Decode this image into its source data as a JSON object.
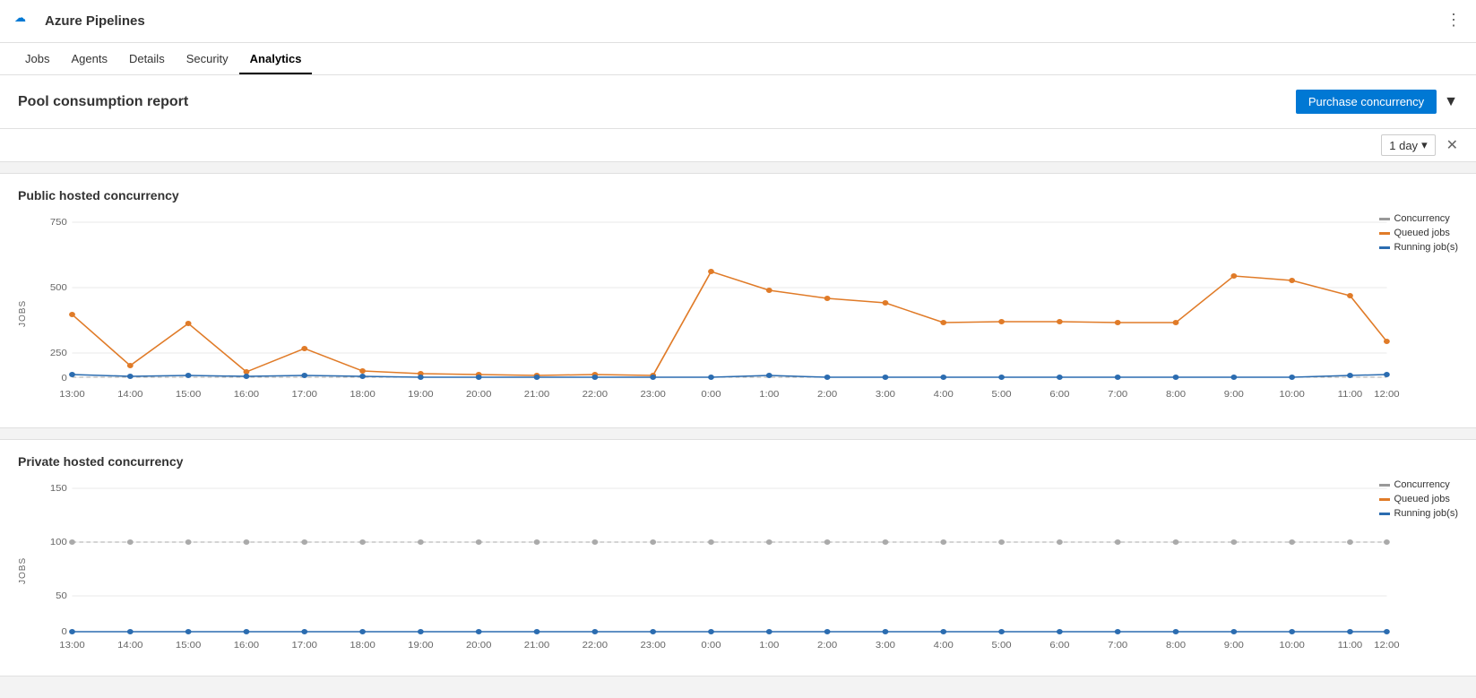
{
  "app": {
    "icon": "☁",
    "title": "Azure Pipelines",
    "more_icon": "⋮"
  },
  "nav": {
    "items": [
      {
        "id": "jobs",
        "label": "Jobs",
        "active": false
      },
      {
        "id": "agents",
        "label": "Agents",
        "active": false
      },
      {
        "id": "details",
        "label": "Details",
        "active": false
      },
      {
        "id": "security",
        "label": "Security",
        "active": false
      },
      {
        "id": "analytics",
        "label": "Analytics",
        "active": true
      }
    ]
  },
  "page": {
    "title": "Pool consumption report",
    "purchase_btn": "Purchase concurrency",
    "day_selector": "1 day"
  },
  "legend": {
    "concurrency": "Concurrency",
    "queued": "Queued jobs",
    "running": "Running job(s)"
  },
  "public_chart": {
    "title": "Public hosted concurrency",
    "y_label": "JOBS",
    "y_max": 750,
    "y_ticks": [
      0,
      250,
      500,
      750
    ],
    "x_ticks": [
      "13:00",
      "14:00",
      "15:00",
      "16:00",
      "17:00",
      "18:00",
      "19:00",
      "20:00",
      "21:00",
      "22:00",
      "23:00",
      "0:00",
      "1:00",
      "2:00",
      "3:00",
      "4:00",
      "5:00",
      "6:00",
      "7:00",
      "8:00",
      "9:00",
      "10:00",
      "11:00",
      "12:00"
    ]
  },
  "private_chart": {
    "title": "Private hosted concurrency",
    "y_label": "JOBS",
    "y_max": 150,
    "y_ticks": [
      0,
      50,
      100,
      150
    ],
    "x_ticks": [
      "13:00",
      "14:00",
      "15:00",
      "16:00",
      "17:00",
      "18:00",
      "19:00",
      "20:00",
      "21:00",
      "22:00",
      "23:00",
      "0:00",
      "1:00",
      "2:00",
      "3:00",
      "4:00",
      "5:00",
      "6:00",
      "7:00",
      "8:00",
      "9:00",
      "10:00",
      "11:00",
      "12:00"
    ]
  }
}
